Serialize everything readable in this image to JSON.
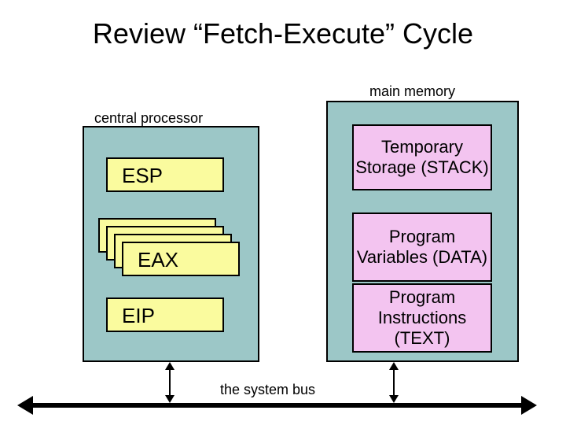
{
  "title": "Review “Fetch-Execute” Cycle",
  "labels": {
    "main_memory": "main memory",
    "central_processor": "central processor",
    "system_bus": "the system bus"
  },
  "registers": {
    "esp": "ESP",
    "eax": "EAX",
    "eip": "EIP"
  },
  "memory_segments": {
    "stack": "Temporary Storage (STACK)",
    "data": "Program Variables (DATA)",
    "text": "Program Instructions (TEXT)"
  }
}
